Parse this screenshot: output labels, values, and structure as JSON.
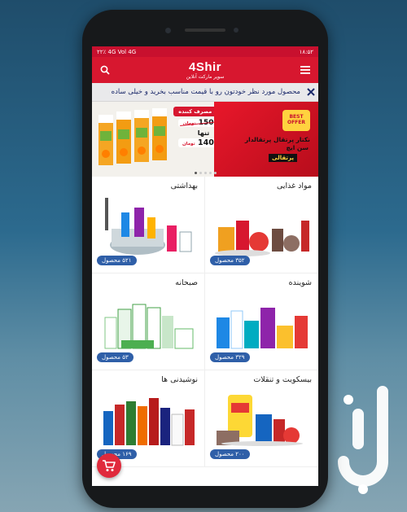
{
  "statusbar": {
    "time": "۱۸:۵۲",
    "indicators": "۲۲٪ 4G Vol 4G"
  },
  "appbar": {
    "brand": "4Shir",
    "subtitle": "سوپر مارکت آنلاین",
    "menu_icon": "hamburger-menu-icon",
    "search_icon": "search-icon"
  },
  "marquee": {
    "text": "محصول مورد نظر خودتون رو با قیمت مناسب بخرید و خیلی ساده",
    "close_icon": "close-icon"
  },
  "banner": {
    "badge": "BEST OFFER",
    "title": "نکتار پرتقال پرتقالدار",
    "subtitle": "سن ایچ",
    "brand": "پرتقالی",
    "consumer_price_label": "قیمت مصرف کننده",
    "old_price": "15000",
    "only_label": "تنها",
    "new_price": "14000",
    "currency": "تومان",
    "slides": 5,
    "active_slide": 0
  },
  "categories": [
    {
      "title": "مواد غذایی",
      "count": "۳۵۲ محصول",
      "art": "groceries"
    },
    {
      "title": "بهداشتی",
      "count": "۵۲۱ محصول",
      "art": "cleaning"
    },
    {
      "title": "شوینده",
      "count": "۳۲۹ محصول",
      "art": "detergent"
    },
    {
      "title": "صبحانه",
      "count": "۵۳ محصول",
      "art": "breakfast"
    },
    {
      "title": "بیسکویت و تنقلات",
      "count": "۲۰۰ محصول",
      "art": "snacks"
    },
    {
      "title": "نوشیدنی ها",
      "count": "۱۶۹ محصول",
      "art": "drinks"
    }
  ],
  "fab": {
    "icon": "shopping-cart-icon"
  },
  "colors": {
    "primary": "#d7172f",
    "badge": "#2f5fa8"
  }
}
